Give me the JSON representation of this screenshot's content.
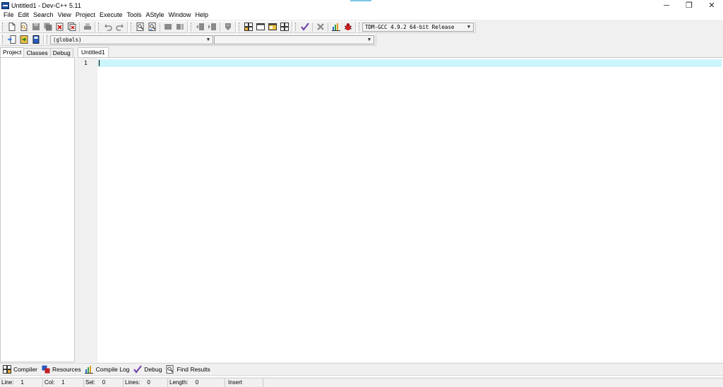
{
  "window": {
    "title": "Untitled1 - Dev-C++ 5.11",
    "minimize_glyph": "─",
    "restore_glyph": "❐",
    "close_glyph": "✕"
  },
  "menu": [
    "File",
    "Edit",
    "Search",
    "View",
    "Project",
    "Execute",
    "Tools",
    "AStyle",
    "Window",
    "Help"
  ],
  "toolbar": {
    "compiler_select": "TDM-GCC 4.9.2 64-bit Release",
    "scope_select": "(globals)",
    "member_select": ""
  },
  "left_tabs": [
    "Project",
    "Classes",
    "Debug"
  ],
  "editor": {
    "tab_label": "Untitled1",
    "line_number": "1",
    "current_line_color": "#ccf5fb"
  },
  "bottom_tabs": [
    "Compiler",
    "Resources",
    "Compile Log",
    "Debug",
    "Find Results"
  ],
  "status": {
    "line_label": "Line:",
    "line_value": "1",
    "col_label": "Col:",
    "col_value": "1",
    "sel_label": "Sel:",
    "sel_value": "0",
    "lines_label": "Lines:",
    "lines_value": "0",
    "length_label": "Length:",
    "length_value": "0",
    "mode": "Insert"
  }
}
